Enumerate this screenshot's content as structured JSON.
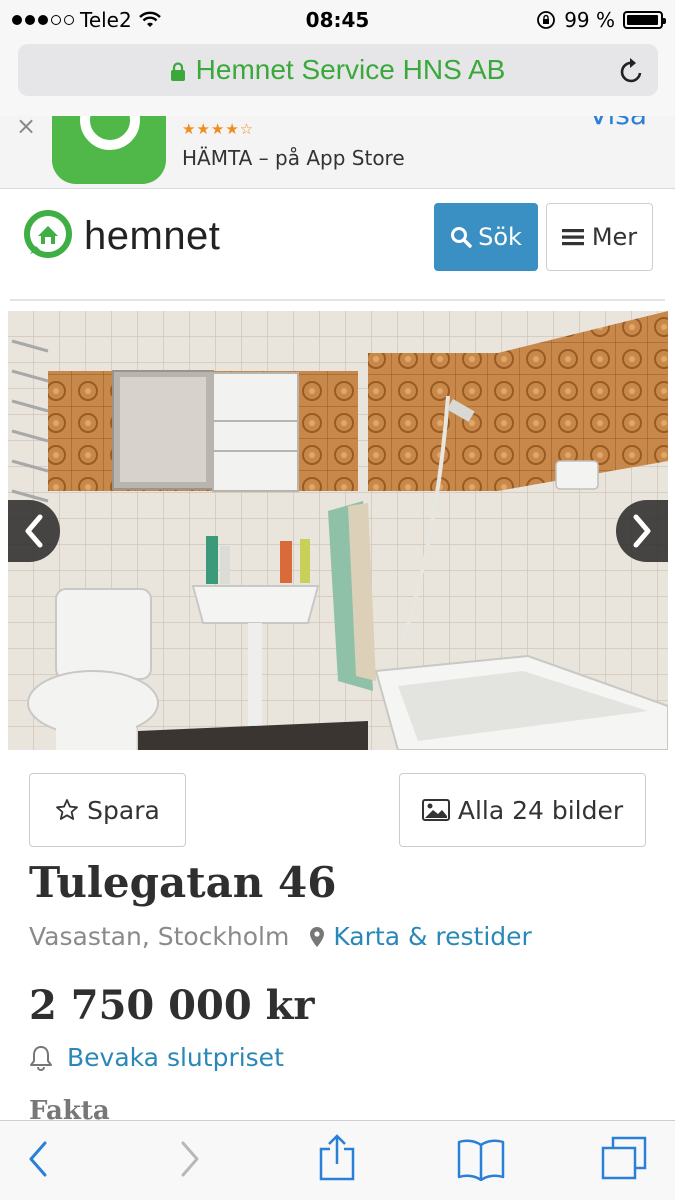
{
  "status_bar": {
    "carrier": "Tele2",
    "time": "08:45",
    "battery": "99 %",
    "signal_icon": "signal-dots-icon",
    "wifi_icon": "wifi-icon",
    "rotation_lock_icon": "rotation-lock-icon"
  },
  "address_bar": {
    "site_title": "Hemnet Service HNS AB",
    "lock_icon": "lock-icon",
    "reload_icon": "reload-icon",
    "accent": "#3aa83a"
  },
  "app_banner": {
    "close": "×",
    "rating_stars": "★★★★☆",
    "rating": 4.5,
    "get_text": "HÄMTA – på App Store",
    "view_label": "Visa"
  },
  "header": {
    "logo_text": "hemnet",
    "search_button": "Sök",
    "more_button": "Mer",
    "brand_color": "#3a8fc3"
  },
  "gallery": {
    "prev_icon": "chevron-left-icon",
    "next_icon": "chevron-right-icon"
  },
  "actions": {
    "save_label": "Spara",
    "all_images_label": "Alla 24 bilder"
  },
  "listing": {
    "title": "Tulegatan 46",
    "area": "Vasastan, Stockholm",
    "map_link": "Karta & restider",
    "price": "2 750 000 kr",
    "watch_link": "Bevaka slutpriset",
    "section_heading": "Fakta"
  },
  "toolbar": {
    "back_icon": "back-chevron-icon",
    "forward_icon": "forward-chevron-icon",
    "share_icon": "share-icon",
    "bookmarks_icon": "book-icon",
    "tabs_icon": "tabs-icon"
  }
}
